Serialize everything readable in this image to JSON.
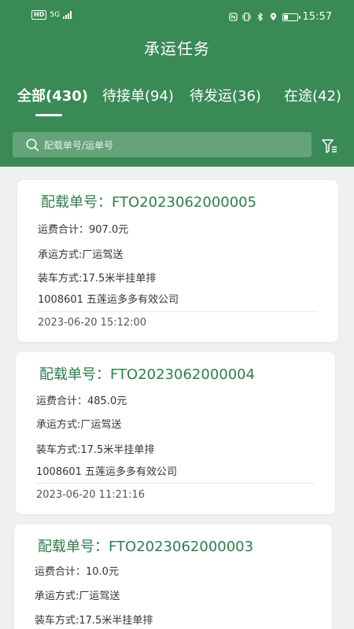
{
  "status_bar": {
    "left": {
      "hd": "HD",
      "network": "5G"
    },
    "time": "15:57",
    "icons": [
      "nfc-icon",
      "vibrate-icon",
      "bluetooth-icon",
      "location-icon",
      "battery-icon"
    ],
    "battery_level": 0.35
  },
  "header": {
    "title": "承运任务",
    "tabs": [
      {
        "label": "全部(430)",
        "active": true
      },
      {
        "label": "待接单(94)",
        "active": false
      },
      {
        "label": "待发运(36)",
        "active": false
      },
      {
        "label": "在途(42)",
        "active": false
      }
    ],
    "search": {
      "placeholder": "配载单号/运单号"
    },
    "filter_icon": "filter-icon"
  },
  "orders": [
    {
      "title": "配载单号：FTO2023062000005",
      "freight": "运费合计：907.0元",
      "transport_mode": "承运方式:厂运驾送",
      "loading_mode": "装车方式:17.5米半挂单排",
      "company": "1008601 五莲运多多有效公司",
      "time": "2023-06-20 15:12:00"
    },
    {
      "title": "配载单号：FTO2023062000004",
      "freight": "运费合计：485.0元",
      "transport_mode": "承运方式:厂运驾送",
      "loading_mode": "装车方式:17.5米半挂单排",
      "company": "1008601 五莲运多多有效公司",
      "time": "2023-06-20 11:21:16"
    },
    {
      "title": "配载单号：FTO2023062000003",
      "freight": "运费合计：10.0元",
      "transport_mode": "承运方式:厂运驾送",
      "loading_mode": "装车方式:17.5米半挂单排"
    }
  ],
  "colors": {
    "primary": "#3a8a55",
    "title_green": "#2f7d4c",
    "background": "#eef1ef"
  }
}
